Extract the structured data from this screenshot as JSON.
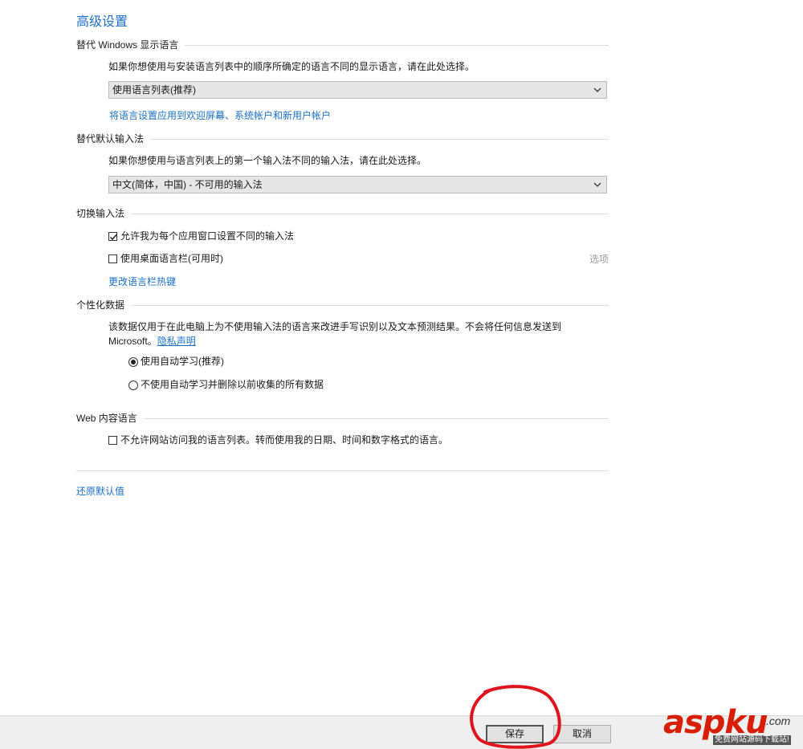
{
  "page_title": "高级设置",
  "display_language": {
    "heading": "替代 Windows 显示语言",
    "description": "如果你想使用与安装语言列表中的顺序所确定的语言不同的显示语言，请在此处选择。",
    "selected": "使用语言列表(推荐)",
    "apply_link": "将语言设置应用到欢迎屏幕、系统帐户和新用户帐户"
  },
  "input_method": {
    "heading": "替代默认输入法",
    "description": "如果你想使用与语言列表上的第一个输入法不同的输入法，请在此处选择。",
    "selected": "中文(简体，中国) - 不可用的输入法"
  },
  "switch_input": {
    "heading": "切换输入法",
    "option_per_app": {
      "label": "允许我为每个应用窗口设置不同的输入法",
      "checked": true
    },
    "option_langbar": {
      "label": "使用桌面语言栏(可用时)",
      "checked": false
    },
    "options_link": "选项",
    "hotkey_link": "更改语言栏热键"
  },
  "personalization": {
    "heading": "个性化数据",
    "description_line1": "该数据仅用于在此电脑上为不使用输入法的语言来改进手写识别以及文本预测结果。不会将任何信息发送到",
    "description_line2": "Microsoft。",
    "privacy_link": "隐私声明",
    "option_auto": {
      "label": "使用自动学习(推荐)",
      "selected": true
    },
    "option_no_auto": {
      "label": "不使用自动学习并删除以前收集的所有数据",
      "selected": false
    }
  },
  "web_content": {
    "heading": "Web 内容语言",
    "option": {
      "label": "不允许网站访问我的语言列表。转而使用我的日期、时间和数字格式的语言。",
      "checked": false
    }
  },
  "restore_link": "还原默认值",
  "footer": {
    "save_label": "保存",
    "cancel_label": "取消"
  },
  "watermark": {
    "brand": "aspku",
    "domain": ".com",
    "tagline": "免费网站源码下载站!"
  },
  "colors": {
    "link": "#1a6fc9",
    "title": "#1f6fc5",
    "annotation_circle": "#e0141c",
    "watermark_red": "#d81e06"
  }
}
